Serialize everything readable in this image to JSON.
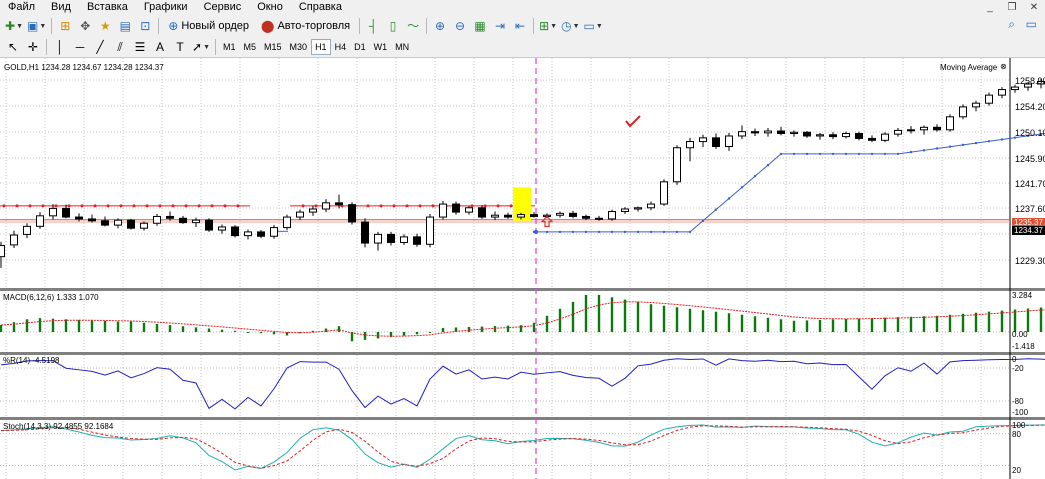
{
  "menu": [
    "Файл",
    "Вид",
    "Вставка",
    "Графики",
    "Сервис",
    "Окно",
    "Справка"
  ],
  "window_controls": [
    "_",
    "❐",
    "✕"
  ],
  "toolbar": {
    "new_order_label": "Новый ордер",
    "auto_trading_label": "Авто-торговля",
    "icons": [
      "new-chart-icon",
      "profiles-icon",
      "market-watch-icon",
      "navigator-icon",
      "favorites-icon",
      "terminal-icon",
      "tester-icon",
      "new-order-icon",
      "auto-trading-icon",
      "bar-chart-icon",
      "candle-chart-icon",
      "line-chart-icon",
      "zoom-in-icon",
      "zoom-out-icon",
      "tile-icon",
      "autoscroll-icon",
      "chart-shift-icon",
      "indicators-icon",
      "periods-icon",
      "templates-icon",
      "search-icon",
      "chat-icon"
    ]
  },
  "drawing_tools": [
    "cursor-icon",
    "crosshair-icon",
    "vertical-line-icon",
    "horizontal-line-icon",
    "trendline-icon",
    "equidistant-icon",
    "fibonacci-icon",
    "text-tool-icon",
    "text-label-icon",
    "arrows-icon"
  ],
  "drawing_labels": {
    "text_tool": "A",
    "text_label": "T"
  },
  "timeframes": [
    "M1",
    "M5",
    "M15",
    "M30",
    "H1",
    "H4",
    "D1",
    "W1",
    "MN"
  ],
  "active_timeframe": "H1",
  "chart": {
    "symbol_header": "GOLD,H1 1234.28 1234.67 1234.28 1234.37",
    "indicator_name": "Moving Average",
    "price_labels": [
      "1258.90",
      "1254.20",
      "1250.10",
      "1245.90",
      "1241.70",
      "1237.60",
      "1229.30"
    ],
    "price_badges": [
      {
        "text": "1235.37",
        "color": "#e05030"
      },
      {
        "text": "1234.37",
        "color": "#000000"
      }
    ],
    "colors": {
      "bull_candle": "#ffffff",
      "bear_candle": "#000000",
      "ma_line": "#3a5fd0",
      "red_line": "#e0202a",
      "macd_hist": "#0a7a0a",
      "macd_signal": "#e02020",
      "wpr_line": "#2020c0",
      "stoch_main": "#20b0b0",
      "stoch_signal": "#e02020",
      "vline": "#e040e0",
      "highlight": "#ffff00"
    },
    "candles": [
      {
        "o": 1229.4,
        "h": 1231.8,
        "l": 1227.6,
        "c": 1231.2
      },
      {
        "o": 1231.3,
        "h": 1233.6,
        "l": 1230.8,
        "c": 1232.9
      },
      {
        "o": 1233.0,
        "h": 1234.8,
        "l": 1232.4,
        "c": 1234.3
      },
      {
        "o": 1234.3,
        "h": 1236.6,
        "l": 1233.9,
        "c": 1236.0
      },
      {
        "o": 1236.0,
        "h": 1237.9,
        "l": 1235.4,
        "c": 1237.2
      },
      {
        "o": 1237.2,
        "h": 1237.8,
        "l": 1235.6,
        "c": 1235.8
      },
      {
        "o": 1235.8,
        "h": 1236.4,
        "l": 1235.1,
        "c": 1235.5
      },
      {
        "o": 1235.5,
        "h": 1236.2,
        "l": 1234.9,
        "c": 1235.2
      },
      {
        "o": 1235.2,
        "h": 1235.9,
        "l": 1234.3,
        "c": 1234.5
      },
      {
        "o": 1234.5,
        "h": 1235.6,
        "l": 1234.0,
        "c": 1235.3
      },
      {
        "o": 1235.3,
        "h": 1235.5,
        "l": 1233.8,
        "c": 1234.0
      },
      {
        "o": 1234.0,
        "h": 1235.1,
        "l": 1233.6,
        "c": 1234.8
      },
      {
        "o": 1234.8,
        "h": 1236.3,
        "l": 1234.4,
        "c": 1235.9
      },
      {
        "o": 1235.9,
        "h": 1236.7,
        "l": 1235.2,
        "c": 1235.6
      },
      {
        "o": 1235.6,
        "h": 1236.0,
        "l": 1234.7,
        "c": 1234.9
      },
      {
        "o": 1234.9,
        "h": 1235.7,
        "l": 1234.2,
        "c": 1235.3
      },
      {
        "o": 1235.3,
        "h": 1235.6,
        "l": 1233.4,
        "c": 1233.7
      },
      {
        "o": 1233.7,
        "h": 1234.6,
        "l": 1233.1,
        "c": 1234.2
      },
      {
        "o": 1234.2,
        "h": 1234.5,
        "l": 1232.5,
        "c": 1232.8
      },
      {
        "o": 1232.8,
        "h": 1233.8,
        "l": 1232.2,
        "c": 1233.4
      },
      {
        "o": 1233.4,
        "h": 1233.7,
        "l": 1232.4,
        "c": 1232.7
      },
      {
        "o": 1232.7,
        "h": 1234.5,
        "l": 1232.3,
        "c": 1234.1
      },
      {
        "o": 1234.1,
        "h": 1236.2,
        "l": 1233.7,
        "c": 1235.8
      },
      {
        "o": 1235.8,
        "h": 1237.0,
        "l": 1235.3,
        "c": 1236.6
      },
      {
        "o": 1236.6,
        "h": 1237.6,
        "l": 1236.0,
        "c": 1237.1
      },
      {
        "o": 1237.1,
        "h": 1238.7,
        "l": 1236.6,
        "c": 1238.1
      },
      {
        "o": 1238.1,
        "h": 1239.4,
        "l": 1237.2,
        "c": 1237.8
      },
      {
        "o": 1237.8,
        "h": 1238.2,
        "l": 1234.6,
        "c": 1235.0
      },
      {
        "o": 1235.0,
        "h": 1235.6,
        "l": 1230.9,
        "c": 1231.6
      },
      {
        "o": 1231.6,
        "h": 1233.4,
        "l": 1230.4,
        "c": 1233.0
      },
      {
        "o": 1233.0,
        "h": 1233.4,
        "l": 1231.2,
        "c": 1231.7
      },
      {
        "o": 1231.7,
        "h": 1233.0,
        "l": 1231.3,
        "c": 1232.6
      },
      {
        "o": 1232.6,
        "h": 1233.1,
        "l": 1231.0,
        "c": 1231.4
      },
      {
        "o": 1231.4,
        "h": 1236.3,
        "l": 1230.9,
        "c": 1235.8
      },
      {
        "o": 1235.8,
        "h": 1238.4,
        "l": 1235.4,
        "c": 1237.9
      },
      {
        "o": 1237.9,
        "h": 1238.3,
        "l": 1236.2,
        "c": 1236.6
      },
      {
        "o": 1236.6,
        "h": 1237.6,
        "l": 1236.2,
        "c": 1237.3
      },
      {
        "o": 1237.3,
        "h": 1237.7,
        "l": 1235.5,
        "c": 1235.8
      },
      {
        "o": 1235.8,
        "h": 1236.7,
        "l": 1235.3,
        "c": 1236.1
      },
      {
        "o": 1236.1,
        "h": 1236.5,
        "l": 1235.5,
        "c": 1235.8
      },
      {
        "o": 1235.8,
        "h": 1236.5,
        "l": 1235.4,
        "c": 1236.2
      },
      {
        "o": 1236.2,
        "h": 1236.6,
        "l": 1235.7,
        "c": 1235.9
      },
      {
        "o": 1235.9,
        "h": 1236.4,
        "l": 1235.6,
        "c": 1236.1
      },
      {
        "o": 1236.1,
        "h": 1236.7,
        "l": 1235.7,
        "c": 1236.4
      },
      {
        "o": 1236.4,
        "h": 1236.8,
        "l": 1235.6,
        "c": 1235.9
      },
      {
        "o": 1235.9,
        "h": 1236.2,
        "l": 1235.3,
        "c": 1235.6
      },
      {
        "o": 1235.6,
        "h": 1236.0,
        "l": 1235.2,
        "c": 1235.5
      },
      {
        "o": 1235.5,
        "h": 1237.0,
        "l": 1235.2,
        "c": 1236.7
      },
      {
        "o": 1236.7,
        "h": 1237.4,
        "l": 1236.3,
        "c": 1237.1
      },
      {
        "o": 1237.1,
        "h": 1237.5,
        "l": 1236.7,
        "c": 1237.3
      },
      {
        "o": 1237.3,
        "h": 1238.3,
        "l": 1236.9,
        "c": 1237.9
      },
      {
        "o": 1237.9,
        "h": 1241.9,
        "l": 1237.6,
        "c": 1241.5
      },
      {
        "o": 1241.5,
        "h": 1247.4,
        "l": 1241.0,
        "c": 1247.0
      },
      {
        "o": 1247.0,
        "h": 1248.6,
        "l": 1244.8,
        "c": 1248.0
      },
      {
        "o": 1248.0,
        "h": 1249.1,
        "l": 1247.1,
        "c": 1248.6
      },
      {
        "o": 1248.6,
        "h": 1249.3,
        "l": 1246.8,
        "c": 1247.2
      },
      {
        "o": 1247.2,
        "h": 1249.4,
        "l": 1246.5,
        "c": 1248.9
      },
      {
        "o": 1248.9,
        "h": 1250.6,
        "l": 1248.4,
        "c": 1249.6
      },
      {
        "o": 1249.6,
        "h": 1250.1,
        "l": 1248.9,
        "c": 1249.4
      },
      {
        "o": 1249.4,
        "h": 1250.2,
        "l": 1248.8,
        "c": 1249.7
      },
      {
        "o": 1249.7,
        "h": 1250.4,
        "l": 1249.0,
        "c": 1249.3
      },
      {
        "o": 1249.3,
        "h": 1249.8,
        "l": 1248.8,
        "c": 1249.5
      },
      {
        "o": 1249.5,
        "h": 1249.7,
        "l": 1248.6,
        "c": 1248.9
      },
      {
        "o": 1248.9,
        "h": 1249.4,
        "l": 1248.3,
        "c": 1249.1
      },
      {
        "o": 1249.1,
        "h": 1249.5,
        "l": 1248.4,
        "c": 1248.8
      },
      {
        "o": 1248.8,
        "h": 1249.6,
        "l": 1248.5,
        "c": 1249.3
      },
      {
        "o": 1249.3,
        "h": 1249.6,
        "l": 1248.2,
        "c": 1248.5
      },
      {
        "o": 1248.5,
        "h": 1249.0,
        "l": 1247.9,
        "c": 1248.2
      },
      {
        "o": 1248.2,
        "h": 1249.5,
        "l": 1247.9,
        "c": 1249.2
      },
      {
        "o": 1249.2,
        "h": 1250.2,
        "l": 1248.8,
        "c": 1249.8
      },
      {
        "o": 1249.8,
        "h": 1250.5,
        "l": 1249.3,
        "c": 1249.9
      },
      {
        "o": 1249.9,
        "h": 1250.6,
        "l": 1249.1,
        "c": 1250.3
      },
      {
        "o": 1250.3,
        "h": 1250.8,
        "l": 1249.6,
        "c": 1249.9
      },
      {
        "o": 1249.9,
        "h": 1252.4,
        "l": 1249.6,
        "c": 1252.0
      },
      {
        "o": 1252.0,
        "h": 1254.0,
        "l": 1251.6,
        "c": 1253.6
      },
      {
        "o": 1253.6,
        "h": 1254.6,
        "l": 1252.9,
        "c": 1254.2
      },
      {
        "o": 1254.2,
        "h": 1255.9,
        "l": 1253.8,
        "c": 1255.5
      },
      {
        "o": 1255.5,
        "h": 1256.8,
        "l": 1255.0,
        "c": 1256.4
      },
      {
        "o": 1256.4,
        "h": 1257.2,
        "l": 1255.9,
        "c": 1256.8
      },
      {
        "o": 1256.8,
        "h": 1257.6,
        "l": 1256.2,
        "c": 1257.3
      },
      {
        "o": 1257.3,
        "h": 1258.1,
        "l": 1256.6,
        "c": 1257.7
      },
      {
        "o": 1257.7,
        "h": 1259.8,
        "l": 1257.3,
        "c": 1259.2
      },
      {
        "o": 1259.2,
        "h": 1259.7,
        "l": 1251.9,
        "c": 1253.8
      },
      {
        "o": 1253.8,
        "h": 1256.6,
        "l": 1253.3,
        "c": 1256.0
      },
      {
        "o": 1256.0,
        "h": 1257.3,
        "l": 1254.2,
        "c": 1256.9
      },
      {
        "o": 1256.9,
        "h": 1257.5,
        "l": 1256.1,
        "c": 1257.1
      },
      {
        "o": 1257.1,
        "h": 1258.1,
        "l": 1256.7,
        "c": 1257.7
      },
      {
        "o": 1257.7,
        "h": 1258.4,
        "l": 1257.0,
        "c": 1258.0
      },
      {
        "o": 1258.0,
        "h": 1258.7,
        "l": 1257.2,
        "c": 1258.3
      },
      {
        "o": 1258.3,
        "h": 1258.6,
        "l": 1256.8,
        "c": 1257.1
      },
      {
        "o": 1257.1,
        "h": 1257.9,
        "l": 1256.4,
        "c": 1257.5
      },
      {
        "o": 1257.5,
        "h": 1257.8,
        "l": 1255.1,
        "c": 1255.5
      },
      {
        "o": 1255.5,
        "h": 1256.6,
        "l": 1255.0,
        "c": 1256.2
      },
      {
        "o": 1256.2,
        "h": 1258.9,
        "l": 1255.7,
        "c": 1257.8
      },
      {
        "o": 1257.8,
        "h": 1258.2,
        "l": 1255.8,
        "c": 1256.4
      },
      {
        "o": 1256.4,
        "h": 1257.0,
        "l": 1255.9,
        "c": 1256.6
      }
    ],
    "ma_line": {
      "flat_value": 1233.4,
      "rise_to": 1246.0,
      "plateau": 1246.0,
      "end": 1253.6
    },
    "red_level": 1237.6,
    "macd": {
      "header": "MACD(6,12,6) 1.333 1.070",
      "labels": [
        "3.284",
        "0.00",
        "-1.418"
      ],
      "max": 3.284,
      "min": -1.418
    },
    "wpr": {
      "header": "%R(14) -4.5198",
      "labels": [
        "0",
        "-20",
        "-80",
        "-100"
      ]
    },
    "stoch": {
      "header": "Stoch(14,3,3) 92.4855 92.1684",
      "labels": [
        "100",
        "80",
        "20"
      ]
    }
  }
}
